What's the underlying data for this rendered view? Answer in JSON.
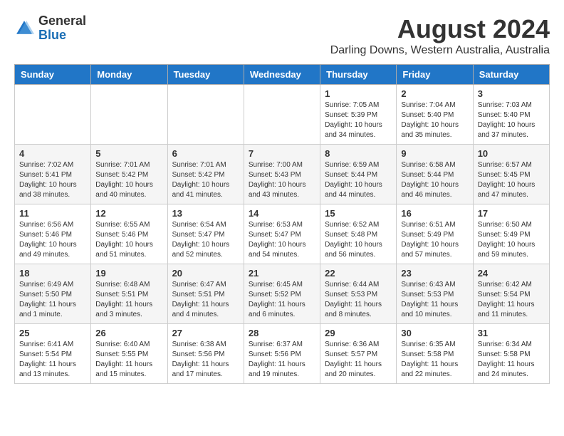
{
  "header": {
    "logo_general": "General",
    "logo_blue": "Blue",
    "title": "August 2024",
    "subtitle": "Darling Downs, Western Australia, Australia"
  },
  "calendar": {
    "weekdays": [
      "Sunday",
      "Monday",
      "Tuesday",
      "Wednesday",
      "Thursday",
      "Friday",
      "Saturday"
    ],
    "weeks": [
      [
        {
          "day": "",
          "info": ""
        },
        {
          "day": "",
          "info": ""
        },
        {
          "day": "",
          "info": ""
        },
        {
          "day": "",
          "info": ""
        },
        {
          "day": "1",
          "info": "Sunrise: 7:05 AM\nSunset: 5:39 PM\nDaylight: 10 hours\nand 34 minutes."
        },
        {
          "day": "2",
          "info": "Sunrise: 7:04 AM\nSunset: 5:40 PM\nDaylight: 10 hours\nand 35 minutes."
        },
        {
          "day": "3",
          "info": "Sunrise: 7:03 AM\nSunset: 5:40 PM\nDaylight: 10 hours\nand 37 minutes."
        }
      ],
      [
        {
          "day": "4",
          "info": "Sunrise: 7:02 AM\nSunset: 5:41 PM\nDaylight: 10 hours\nand 38 minutes."
        },
        {
          "day": "5",
          "info": "Sunrise: 7:01 AM\nSunset: 5:42 PM\nDaylight: 10 hours\nand 40 minutes."
        },
        {
          "day": "6",
          "info": "Sunrise: 7:01 AM\nSunset: 5:42 PM\nDaylight: 10 hours\nand 41 minutes."
        },
        {
          "day": "7",
          "info": "Sunrise: 7:00 AM\nSunset: 5:43 PM\nDaylight: 10 hours\nand 43 minutes."
        },
        {
          "day": "8",
          "info": "Sunrise: 6:59 AM\nSunset: 5:44 PM\nDaylight: 10 hours\nand 44 minutes."
        },
        {
          "day": "9",
          "info": "Sunrise: 6:58 AM\nSunset: 5:44 PM\nDaylight: 10 hours\nand 46 minutes."
        },
        {
          "day": "10",
          "info": "Sunrise: 6:57 AM\nSunset: 5:45 PM\nDaylight: 10 hours\nand 47 minutes."
        }
      ],
      [
        {
          "day": "11",
          "info": "Sunrise: 6:56 AM\nSunset: 5:46 PM\nDaylight: 10 hours\nand 49 minutes."
        },
        {
          "day": "12",
          "info": "Sunrise: 6:55 AM\nSunset: 5:46 PM\nDaylight: 10 hours\nand 51 minutes."
        },
        {
          "day": "13",
          "info": "Sunrise: 6:54 AM\nSunset: 5:47 PM\nDaylight: 10 hours\nand 52 minutes."
        },
        {
          "day": "14",
          "info": "Sunrise: 6:53 AM\nSunset: 5:47 PM\nDaylight: 10 hours\nand 54 minutes."
        },
        {
          "day": "15",
          "info": "Sunrise: 6:52 AM\nSunset: 5:48 PM\nDaylight: 10 hours\nand 56 minutes."
        },
        {
          "day": "16",
          "info": "Sunrise: 6:51 AM\nSunset: 5:49 PM\nDaylight: 10 hours\nand 57 minutes."
        },
        {
          "day": "17",
          "info": "Sunrise: 6:50 AM\nSunset: 5:49 PM\nDaylight: 10 hours\nand 59 minutes."
        }
      ],
      [
        {
          "day": "18",
          "info": "Sunrise: 6:49 AM\nSunset: 5:50 PM\nDaylight: 11 hours\nand 1 minute."
        },
        {
          "day": "19",
          "info": "Sunrise: 6:48 AM\nSunset: 5:51 PM\nDaylight: 11 hours\nand 3 minutes."
        },
        {
          "day": "20",
          "info": "Sunrise: 6:47 AM\nSunset: 5:51 PM\nDaylight: 11 hours\nand 4 minutes."
        },
        {
          "day": "21",
          "info": "Sunrise: 6:45 AM\nSunset: 5:52 PM\nDaylight: 11 hours\nand 6 minutes."
        },
        {
          "day": "22",
          "info": "Sunrise: 6:44 AM\nSunset: 5:53 PM\nDaylight: 11 hours\nand 8 minutes."
        },
        {
          "day": "23",
          "info": "Sunrise: 6:43 AM\nSunset: 5:53 PM\nDaylight: 11 hours\nand 10 minutes."
        },
        {
          "day": "24",
          "info": "Sunrise: 6:42 AM\nSunset: 5:54 PM\nDaylight: 11 hours\nand 11 minutes."
        }
      ],
      [
        {
          "day": "25",
          "info": "Sunrise: 6:41 AM\nSunset: 5:54 PM\nDaylight: 11 hours\nand 13 minutes."
        },
        {
          "day": "26",
          "info": "Sunrise: 6:40 AM\nSunset: 5:55 PM\nDaylight: 11 hours\nand 15 minutes."
        },
        {
          "day": "27",
          "info": "Sunrise: 6:38 AM\nSunset: 5:56 PM\nDaylight: 11 hours\nand 17 minutes."
        },
        {
          "day": "28",
          "info": "Sunrise: 6:37 AM\nSunset: 5:56 PM\nDaylight: 11 hours\nand 19 minutes."
        },
        {
          "day": "29",
          "info": "Sunrise: 6:36 AM\nSunset: 5:57 PM\nDaylight: 11 hours\nand 20 minutes."
        },
        {
          "day": "30",
          "info": "Sunrise: 6:35 AM\nSunset: 5:58 PM\nDaylight: 11 hours\nand 22 minutes."
        },
        {
          "day": "31",
          "info": "Sunrise: 6:34 AM\nSunset: 5:58 PM\nDaylight: 11 hours\nand 24 minutes."
        }
      ]
    ]
  }
}
